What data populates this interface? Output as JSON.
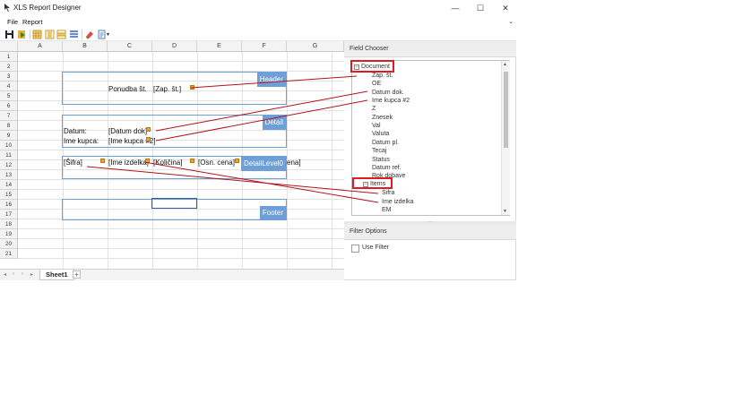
{
  "window": {
    "title": "XLS Report Designer",
    "minimize_icon": "minimize-icon",
    "maximize_icon": "maximize-icon",
    "close_icon": "close-icon"
  },
  "menu": {
    "items": [
      "File",
      "Report"
    ],
    "chevron": "⌄"
  },
  "toolbar": {
    "icons": [
      "save-icon",
      "preview-icon",
      "grid-icon",
      "grid-columns-icon",
      "grid-rows-icon",
      "band-icon",
      "eraser-icon",
      "document-icon"
    ]
  },
  "sheet": {
    "columns": [
      "A",
      "B",
      "C",
      "D",
      "E",
      "F",
      "G"
    ],
    "rows": [
      "1",
      "2",
      "3",
      "4",
      "5",
      "6",
      "7",
      "8",
      "9",
      "10",
      "11",
      "12",
      "13",
      "14",
      "15",
      "16",
      "17",
      "18",
      "19",
      "20",
      "21"
    ],
    "cells": {
      "c4": "Ponudba št.",
      "d4": "[Zap. št.]",
      "b8": "Datum:",
      "c8": "[Datum dok]",
      "b9": "Ime kupca:",
      "c9": "[Ime kupca #2]",
      "b11": "[Šifra]",
      "c11": "[Ime izdelka]",
      "d11": "[Količina]",
      "e11": "[Osn. cena]",
      "f11": "[Zne",
      "g11": "ena]"
    },
    "bands": {
      "header": "Header",
      "detail": "Detail",
      "detail_level": "DetailLevel0",
      "footer": "Footer"
    },
    "tabs": {
      "active": "Sheet1",
      "add": "+",
      "nav": [
        "◂",
        "‹",
        "›",
        "▸"
      ]
    }
  },
  "field_chooser": {
    "title": "Field Chooser",
    "document": {
      "label": "Document",
      "toggle": "−",
      "fields": [
        "Zap. št.",
        "OE",
        "Datum dok.",
        "Ime kupca #2",
        "Z",
        "Znesek",
        "Val",
        "Valuta",
        "Datum pl.",
        "Tecaj",
        "Status",
        "Datum ref.",
        "Rok dobave"
      ]
    },
    "items": {
      "label": "Items",
      "toggle": "−",
      "fields": [
        "Šifra",
        "Ime izdelka",
        "EM"
      ]
    }
  },
  "filter_options": {
    "title": "Filter Options",
    "use_filter_label": "Use Filter",
    "use_filter_checked": false
  },
  "colors": {
    "band": "#6f9fd8",
    "highlight": "#e01b24",
    "link": "#b3121b"
  }
}
